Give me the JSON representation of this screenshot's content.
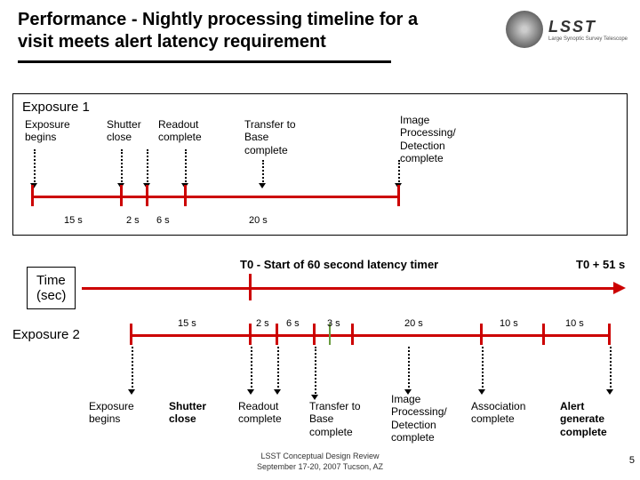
{
  "title": "Performance - Nightly processing timeline for a visit meets alert latency requirement",
  "logo": {
    "main": "LSST",
    "sub": "Large Synoptic Survey Telescope"
  },
  "exposure1": {
    "label": "Exposure 1",
    "events": {
      "begins": "Exposure\nbegins",
      "shutter": "Shutter\nclose",
      "readout": "Readout\ncomplete",
      "transfer": "Transfer to\nBase\ncomplete",
      "image": "Image\nProcessing/\nDetection\ncomplete"
    },
    "durations": {
      "d1": "15 s",
      "d2": "2 s",
      "d3": "6 s",
      "d4": "20 s"
    }
  },
  "time_label": "Time\n(sec)",
  "t0_start": "T0 - Start of 60 second latency timer",
  "t0_end": "T0 + 51 s",
  "exposure2": {
    "label": "Exposure 2",
    "events": {
      "begins": "Exposure\nbegins",
      "shutter": "Shutter\nclose",
      "readout": "Readout\ncomplete",
      "transfer": "Transfer to\nBase\ncomplete",
      "image": "Image\nProcessing/\nDetection\ncomplete",
      "assoc": "Association\ncomplete",
      "alert": "Alert\ngenerate\ncomplete"
    },
    "durations": {
      "d1": "15 s",
      "d2": "2 s",
      "d3": "6 s",
      "d4": "3 s",
      "d5": "20 s",
      "d6": "10 s",
      "d7": "10 s"
    }
  },
  "footer": {
    "l1": "LSST Conceptual Design Review",
    "l2": "September 17-20, 2007 Tucson, AZ"
  },
  "page": "5"
}
